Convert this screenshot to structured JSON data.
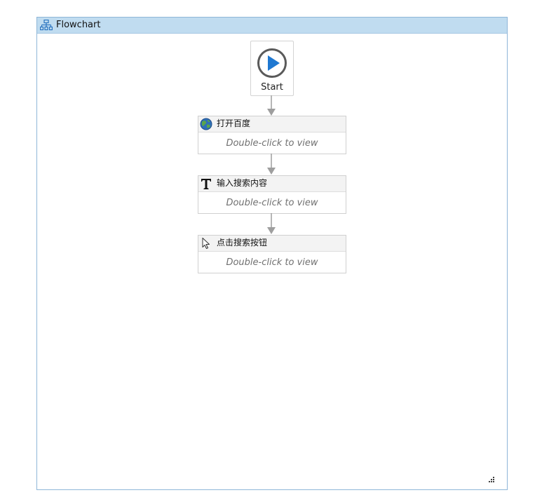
{
  "panel": {
    "title": "Flowchart",
    "icon": "flowchart-icon"
  },
  "start": {
    "label": "Start",
    "icon": "play-circle-icon",
    "accent": "#1f78d1"
  },
  "activities": [
    {
      "title": "打开百度",
      "hint": "Double-click to view",
      "icon": "globe-icon"
    },
    {
      "title": "输入搜索内容",
      "hint": "Double-click to view",
      "icon": "type-text-icon"
    },
    {
      "title": "点击搜索按钮",
      "hint": "Double-click to view",
      "icon": "mouse-pointer-icon"
    }
  ],
  "colors": {
    "panel_border": "#8fb6d8",
    "panel_header": "#c0dcf0",
    "connector": "#9e9e9e",
    "hint_text": "#707070"
  }
}
